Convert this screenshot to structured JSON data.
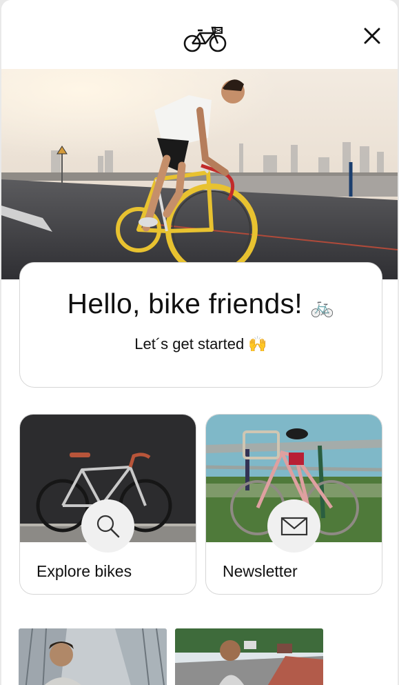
{
  "header": {
    "logo_icon": "bicycle-logo-icon",
    "close_icon": "close-icon"
  },
  "hero": {
    "image": "cyclist-on-road-photo"
  },
  "greeting": {
    "title": "Hello, bike friends!",
    "title_emoji": "🚲",
    "subtitle": "Let´s get started",
    "subtitle_emoji": "🙌"
  },
  "tiles": [
    {
      "label": "Explore bikes",
      "icon": "search-icon"
    },
    {
      "label": "Newsletter",
      "icon": "mail-icon"
    }
  ],
  "colors": {
    "card_border": "#d6d6d6",
    "icon_circle": "#f0f0f0",
    "text": "#111111"
  }
}
